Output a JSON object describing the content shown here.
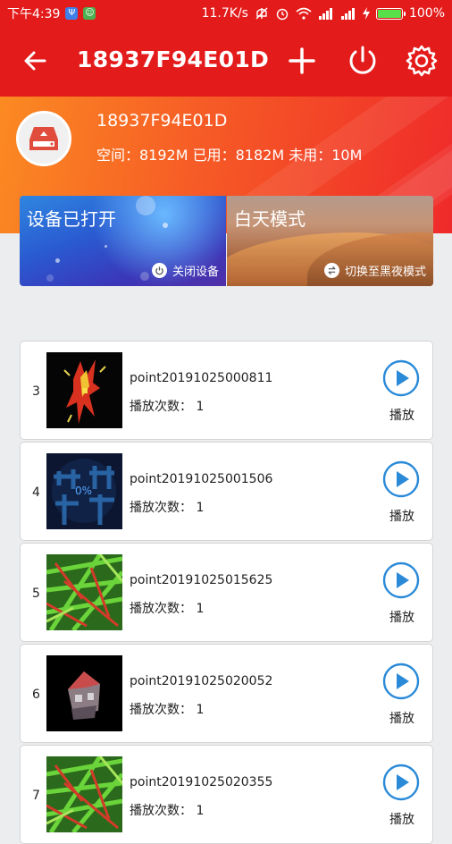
{
  "status": {
    "time": "下午4:39",
    "speed": "11.7K/s",
    "battery": "100%",
    "battery_level": 1.0
  },
  "toolbar": {
    "title": "18937F94E01D"
  },
  "device": {
    "name": "18937F94E01D",
    "space": "空间：8192M  已用：8182M  未用：10M"
  },
  "cards": {
    "left": {
      "title": "设备已打开",
      "action": "关闭设备"
    },
    "right": {
      "title": "白天模式",
      "action": "切换至黑夜模式"
    }
  },
  "list": [
    {
      "index": "3",
      "filename": "point20191025000811",
      "count": "播放次数：  1",
      "play": "播放",
      "thumb": "fire"
    },
    {
      "index": "4",
      "filename": "point20191025001506",
      "count": "播放次数：  1",
      "play": "播放",
      "thumb": "logo",
      "overlay": "0%"
    },
    {
      "index": "5",
      "filename": "point20191025015625",
      "count": "播放次数：  1",
      "play": "播放",
      "thumb": "grass"
    },
    {
      "index": "6",
      "filename": "point20191025020052",
      "count": "播放次数：  1",
      "play": "播放",
      "thumb": "house"
    },
    {
      "index": "7",
      "filename": "point20191025020355",
      "count": "播放次数：  1",
      "play": "播放",
      "thumb": "grass"
    }
  ],
  "colors": {
    "toolbar": "#e41b1b",
    "accent": "#2a8ad8"
  }
}
